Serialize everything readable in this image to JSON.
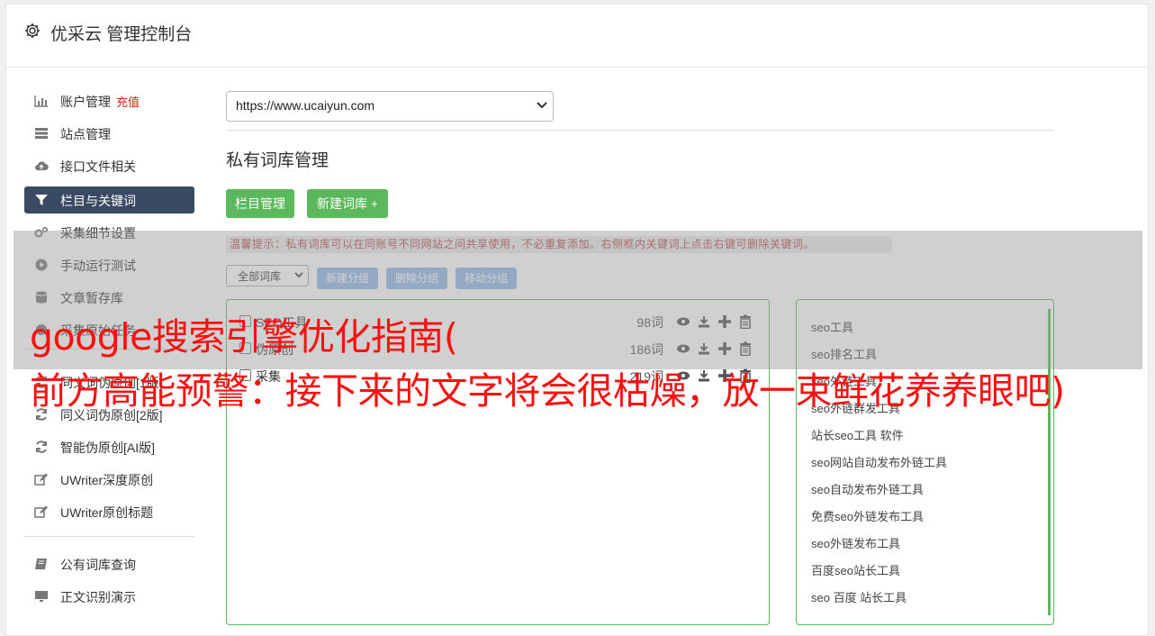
{
  "header": {
    "title": "优采云 管理控制台"
  },
  "sidebar": {
    "items": [
      {
        "label": "账户管理",
        "badge": "充值"
      },
      {
        "label": "站点管理"
      },
      {
        "label": "接口文件相关"
      },
      {
        "label": "栏目与关键词"
      },
      {
        "label": "采集细节设置"
      },
      {
        "label": "手动运行测试"
      },
      {
        "label": "文章暂存库"
      },
      {
        "label": "采集原始任务"
      },
      {
        "label": "同义词伪原创[1版]"
      },
      {
        "label": "同义词伪原创[2版]"
      },
      {
        "label": "智能伪原创[AI版]"
      },
      {
        "label": "UWriter深度原创"
      },
      {
        "label": "UWriter原创标题"
      },
      {
        "label": "公有词库查询"
      },
      {
        "label": "正文识别演示"
      }
    ]
  },
  "main": {
    "site_select": "https://www.ucaiyun.com",
    "heading": "私有词库管理",
    "btn_column": "栏目管理",
    "btn_new_lib": "新建词库 +",
    "tip": "温馨提示：私有词库可以在同账号不同网站之间共享使用，不必重复添加。右侧框内关键词上点击右键可删除关键词。",
    "filter_select": "全部词库",
    "btn_new_group": "新建分组",
    "btn_del_group": "删除分组",
    "btn_move_group": "移动分组",
    "libraries": [
      {
        "name": "SEO工具",
        "count": "98词"
      },
      {
        "name": "伪原创",
        "count": "186词"
      },
      {
        "name": "采集",
        "count": "219词"
      }
    ],
    "keywords": [
      "seo工具",
      "seo排名工具",
      "seo外链工具",
      "seo外链群发工具",
      "站长seo工具 软件",
      "seo网站自动发布外链工具",
      "seo自动发布外链工具",
      "免费seo外链发布工具",
      "seo外链发布工具",
      "百度seo站长工具",
      "seo 百度 站长工具"
    ]
  },
  "overlay": {
    "line1": "google搜索引擎优化指南(",
    "line2": "前方高能预警：接下来的文字将会很枯燥，放一束鲜花养养眼吧)"
  },
  "colors": {
    "green": "#5cb85c",
    "active_nav": "#3b4a63",
    "light_blue": "#93b9e8",
    "overlay_red": "#ff1010"
  }
}
